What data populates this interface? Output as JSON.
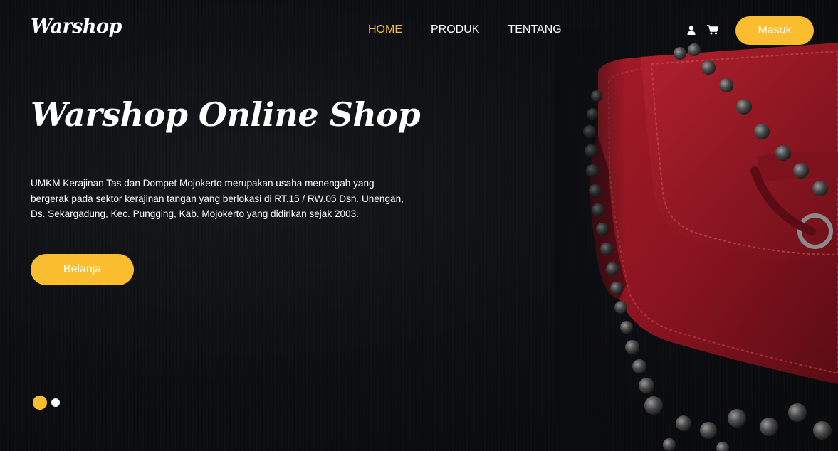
{
  "brand": {
    "logo_text": "Warshop"
  },
  "nav": {
    "links": [
      {
        "label": "HOME",
        "active": true
      },
      {
        "label": "PRODUK",
        "active": false
      },
      {
        "label": "TENTANG",
        "active": false
      }
    ],
    "icons": [
      "user-icon",
      "cart-icon"
    ],
    "login_label": "Masuk"
  },
  "hero": {
    "title": "Warshop Online Shop",
    "description": "UMKM Kerajinan Tas dan Dompet Mojokerto merupakan usaha menengah yang bergerak pada sektor kerajinan tangan yang berlokasi di RT.15 / RW.05 Dsn. Unengan, Ds. Sekargadung, Kec. Pungging, Kab. Mojokerto yang didirikan sejak 2003.",
    "cta_label": "Belanja",
    "image": "red-leather-bag-with-pearl-chain"
  },
  "carousel": {
    "slide_count": 2,
    "active_index": 0
  },
  "colors": {
    "accent": "#fbbd30",
    "background": "#0b0c0e",
    "text": "#ffffff",
    "bag_red": "#8e1420"
  }
}
